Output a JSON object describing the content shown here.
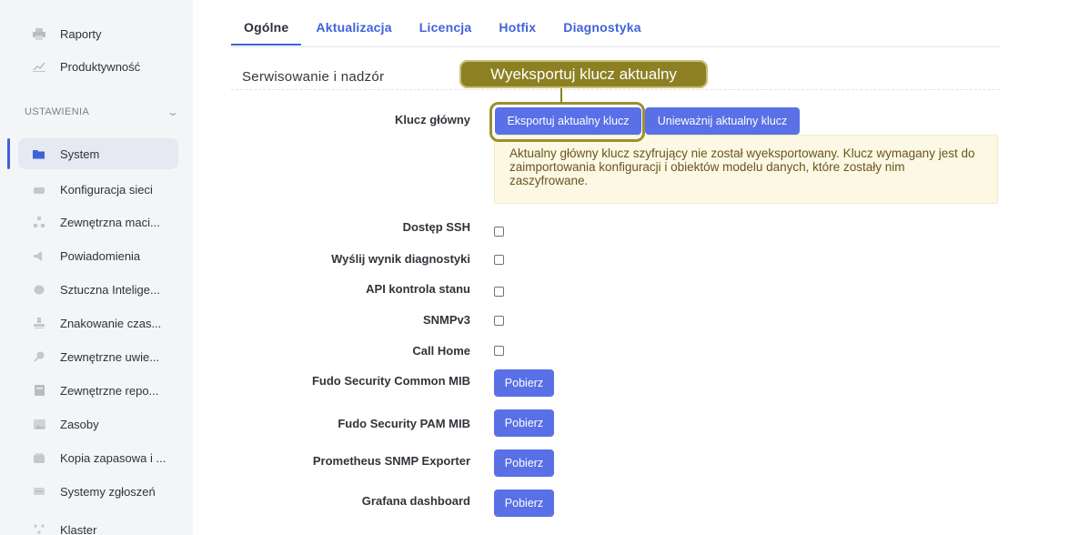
{
  "sidebar": {
    "items_top": [
      {
        "label": "Raporty",
        "icon": "printer-icon"
      },
      {
        "label": "Produktywność",
        "icon": "chart-icon"
      }
    ],
    "section_header": "USTAWIENIA",
    "settings_items": [
      {
        "label": "System",
        "icon": "folder-icon",
        "active": true
      },
      {
        "label": "Konfiguracja sieci",
        "icon": "network-icon"
      },
      {
        "label": "Zewnętrzna maci...",
        "icon": "sitemap-icon"
      },
      {
        "label": "Powiadomienia",
        "icon": "megaphone-icon"
      },
      {
        "label": "Sztuczna Intelige...",
        "icon": "brain-icon"
      },
      {
        "label": "Znakowanie czas...",
        "icon": "stamp-icon"
      },
      {
        "label": "Zewnętrzne uwie...",
        "icon": "key-icon"
      },
      {
        "label": "Zewnętrzne repo...",
        "icon": "repository-icon"
      },
      {
        "label": "Zasoby",
        "icon": "image-icon"
      },
      {
        "label": "Kopia zapasowa i ...",
        "icon": "backup-icon"
      },
      {
        "label": "Systemy zgłoszeń",
        "icon": "ticket-icon"
      },
      {
        "label": "Klaster",
        "icon": "cluster-icon"
      }
    ]
  },
  "tabs": [
    {
      "label": "Ogólne",
      "active": true
    },
    {
      "label": "Aktualizacja"
    },
    {
      "label": "Licencja"
    },
    {
      "label": "Hotfix"
    },
    {
      "label": "Diagnostyka"
    }
  ],
  "section_title": "Serwisowanie i nadzór",
  "tooltip": "Wyeksportuj klucz aktualny",
  "master_key": {
    "label": "Klucz główny",
    "export_button": "Eksportuj aktualny klucz",
    "invalidate_button": "Unieważnij aktualny klucz",
    "warning": "Aktualny główny klucz szyfrujący nie został wyeksportowany. Klucz wymagany jest do zaimportowania konfiguracji i obiektów modelu danych, które zostały nim zaszyfrowane."
  },
  "options": [
    {
      "label": "Dostęp SSH",
      "checked": false
    },
    {
      "label": "Wyślij wynik diagnostyki",
      "checked": false
    },
    {
      "label": "API kontrola stanu",
      "checked": false
    },
    {
      "label": "SNMPv3",
      "checked": false
    },
    {
      "label": "Call Home",
      "checked": false
    }
  ],
  "downloads": [
    {
      "label": "Fudo Security Common MIB",
      "button": "Pobierz"
    },
    {
      "label": "Fudo Security PAM MIB",
      "button": "Pobierz"
    },
    {
      "label": "Prometheus SNMP Exporter",
      "button": "Pobierz"
    },
    {
      "label": "Grafana dashboard",
      "button": "Pobierz"
    }
  ],
  "colors": {
    "accent": "#3f63d8",
    "button": "#5a70e6",
    "tooltip": "#8c8023",
    "warning_bg": "#fcf8e3"
  }
}
